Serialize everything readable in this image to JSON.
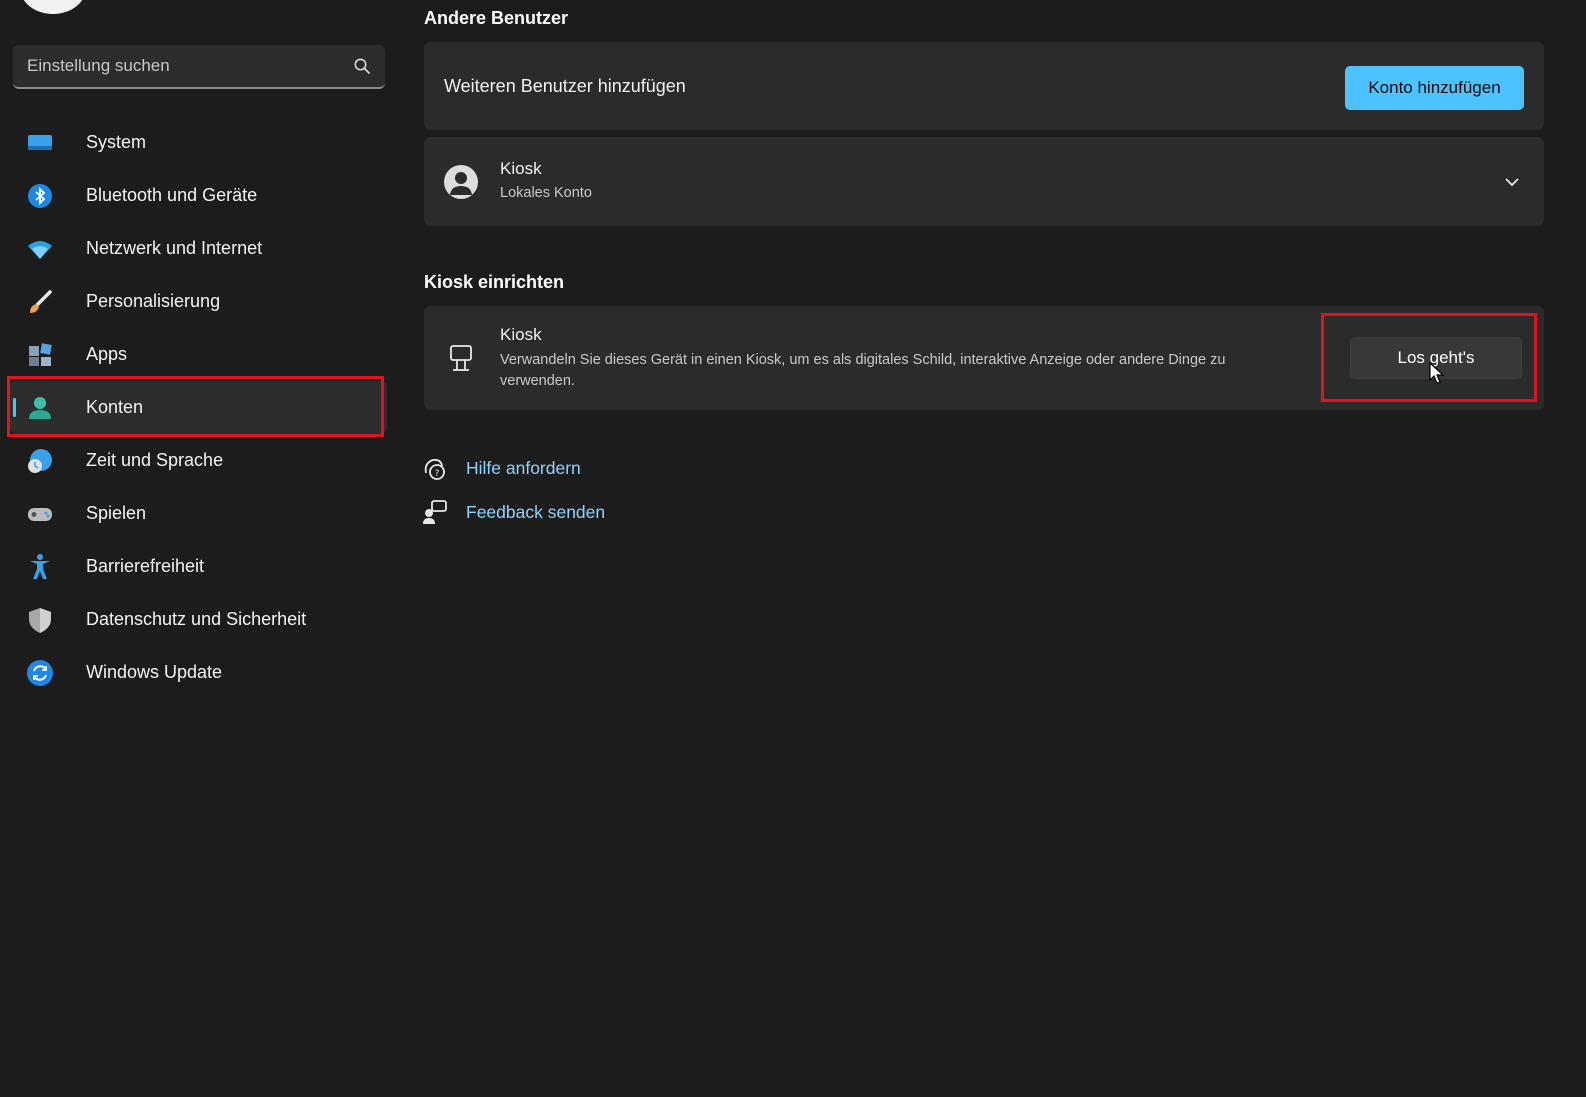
{
  "search": {
    "placeholder": "Einstellung suchen",
    "icon": "search-icon"
  },
  "sidebar": {
    "items": [
      {
        "label": "System",
        "icon": "system-icon",
        "color": "#3aa0e8"
      },
      {
        "label": "Bluetooth und Geräte",
        "icon": "bluetooth-icon",
        "color": "#1e88e5"
      },
      {
        "label": "Netzwerk und Internet",
        "icon": "wifi-icon",
        "color": "#29a3e6"
      },
      {
        "label": "Personalisierung",
        "icon": "brush-icon",
        "color": "#e8a15a"
      },
      {
        "label": "Apps",
        "icon": "apps-icon",
        "color": "#8aa0b8"
      },
      {
        "label": "Konten",
        "icon": "account-icon",
        "color": "#3dc2a8",
        "active": true
      },
      {
        "label": "Zeit und Sprache",
        "icon": "time-language-icon",
        "color": "#3aa0e8"
      },
      {
        "label": "Spielen",
        "icon": "gamepad-icon",
        "color": "#bcbcbc"
      },
      {
        "label": "Barrierefreiheit",
        "icon": "accessibility-icon",
        "color": "#3aa0e8"
      },
      {
        "label": "Datenschutz und Sicherheit",
        "icon": "shield-icon",
        "color": "#a8a8a8"
      },
      {
        "label": "Windows Update",
        "icon": "update-icon",
        "color": "#1e88e5"
      }
    ]
  },
  "main": {
    "other_users": {
      "heading": "Andere Benutzer",
      "add_user_label": "Weiteren Benutzer hinzufügen",
      "add_account_button": "Konto hinzufügen",
      "user": {
        "name": "Kiosk",
        "type": "Lokales Konto"
      }
    },
    "kiosk": {
      "heading": "Kiosk einrichten",
      "title": "Kiosk",
      "description": "Verwandeln Sie dieses Gerät in einen Kiosk, um es als digitales Schild, interaktive Anzeige oder andere Dinge zu verwenden.",
      "button": "Los geht's"
    },
    "links": [
      {
        "label": "Hilfe anfordern",
        "icon": "help-icon"
      },
      {
        "label": "Feedback senden",
        "icon": "feedback-icon"
      }
    ]
  },
  "colors": {
    "accent": "#4cc2ff",
    "highlight": "#e0141e",
    "background": "#1c1c1c",
    "card": "#2b2b2b"
  }
}
